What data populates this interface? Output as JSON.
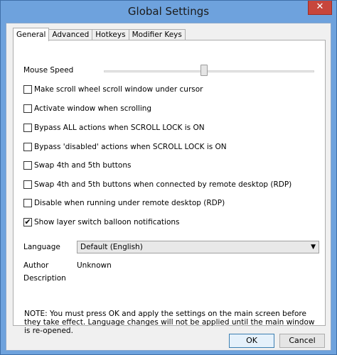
{
  "window": {
    "title": "Global Settings",
    "close_glyph": "✕"
  },
  "tabs": [
    {
      "label": "General"
    },
    {
      "label": "Advanced"
    },
    {
      "label": "Hotkeys"
    },
    {
      "label": "Modifier Keys"
    }
  ],
  "mouse_speed": {
    "label": "Mouse Speed",
    "value_fraction": 0.48
  },
  "checkboxes": [
    {
      "label": "Make scroll wheel scroll window under cursor",
      "checked": false
    },
    {
      "label": "Activate window when scrolling",
      "checked": false
    },
    {
      "label": "Bypass ALL actions when SCROLL LOCK is ON",
      "checked": false
    },
    {
      "label": "Bypass 'disabled' actions when SCROLL LOCK is ON",
      "checked": false
    },
    {
      "label": "Swap 4th and 5th buttons",
      "checked": false
    },
    {
      "label": "Swap 4th and 5th buttons when connected by remote desktop (RDP)",
      "checked": false
    },
    {
      "label": "Disable when running under remote desktop (RDP)",
      "checked": false
    },
    {
      "label": "Show layer switch balloon notifications",
      "checked": true
    }
  ],
  "check_glyph": "✔",
  "language": {
    "label": "Language",
    "value": "Default (English)",
    "arrow": "▼"
  },
  "author": {
    "label": "Author",
    "value": "Unknown"
  },
  "description": {
    "label": "Description"
  },
  "note": "NOTE: You must press OK and apply the settings on the main screen before they take effect. Language changes will not be applied until the main window is re-opened.",
  "buttons": {
    "ok": "OK",
    "cancel": "Cancel"
  }
}
